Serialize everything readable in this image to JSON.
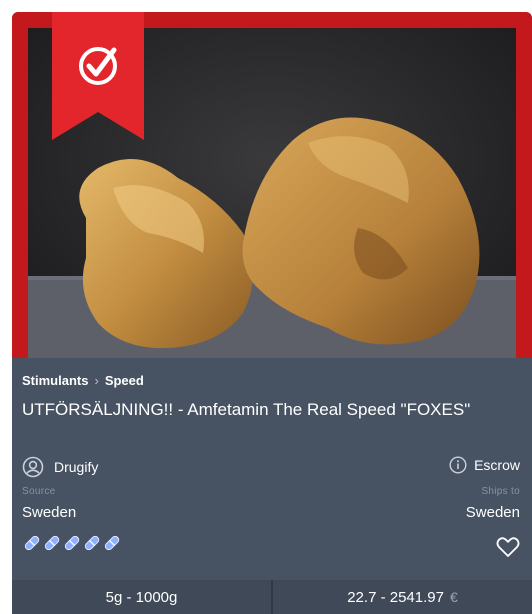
{
  "product": {
    "category": "Stimulants",
    "breadcrumb_separator": "›",
    "subcategory": "Speed",
    "title": "UTFÖRSÄLJNING!! - Amfetamin The Real Speed \"FOXES\"",
    "vendor": "Drugify",
    "escrow_label": "Escrow",
    "source_label": "Source",
    "source_value": "Sweden",
    "ships_to_label": "Ships to",
    "ships_to_value": "Sweden",
    "rating_count": 5
  },
  "footer": {
    "quantity_range": "5g - 1000g",
    "price_range": "22.7 - 2541.97",
    "currency_symbol": "€"
  },
  "colors": {
    "card_bg": "#475263",
    "image_frame": "#c4191c",
    "ribbon": "#e3262c",
    "rating_pill": "#8fb0ff",
    "footer_bg": "#3f4958"
  },
  "icons": {
    "ribbon": "verified-check-icon",
    "vendor": "user-circle-icon",
    "escrow": "info-circle-icon",
    "rating": "pill-icon",
    "favorite": "heart-icon"
  }
}
